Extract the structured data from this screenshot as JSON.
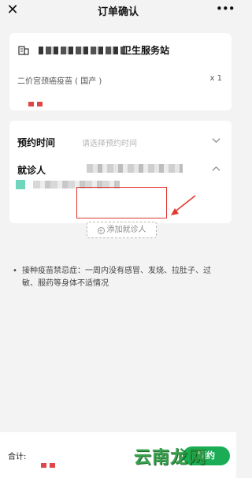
{
  "header": {
    "close_icon": "close-icon",
    "title": "订单确认",
    "more_label": "•••"
  },
  "order": {
    "station_suffix": "卫生服务站",
    "vaccine_name": "二价宫颈癌疫苗 ( 国产 )",
    "quantity": "x 1"
  },
  "form": {
    "appointment_label": "预约时间",
    "appointment_placeholder": "请选择预约时间",
    "patient_label": "就诊人",
    "add_patient_label": "添加就诊人"
  },
  "notes": {
    "bullet": "•",
    "text": "接种疫苗禁忌症：一周内没有感冒、发烧、拉肚子、过敏、服药等身体不适情况"
  },
  "footer": {
    "total_label": "合计:",
    "book_label": "预约"
  },
  "watermark": "云南龙网",
  "colors": {
    "accent": "#1aad56",
    "price_red": "#e04646",
    "highlight": "#e0392e"
  }
}
